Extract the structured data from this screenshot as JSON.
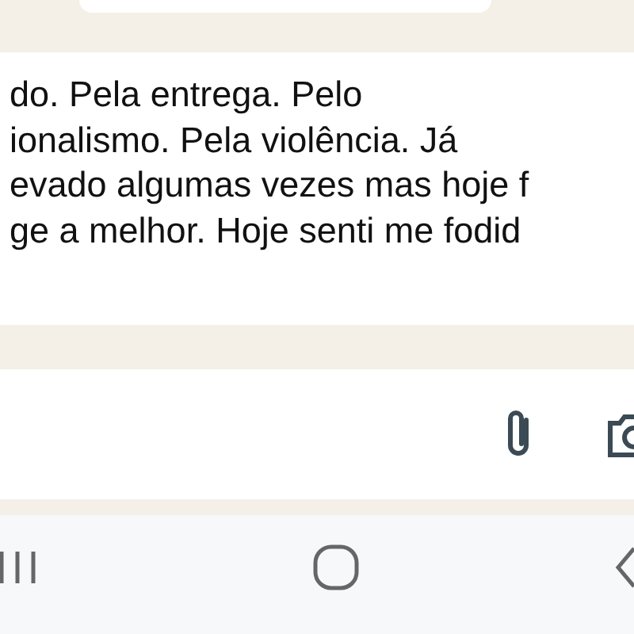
{
  "message": {
    "lines": [
      "do. Pela entrega. Pelo",
      "ionalismo. Pela violência. Já",
      "evado algumas vezes mas hoje f",
      "ge a melhor. Hoje senti me fodid"
    ]
  }
}
